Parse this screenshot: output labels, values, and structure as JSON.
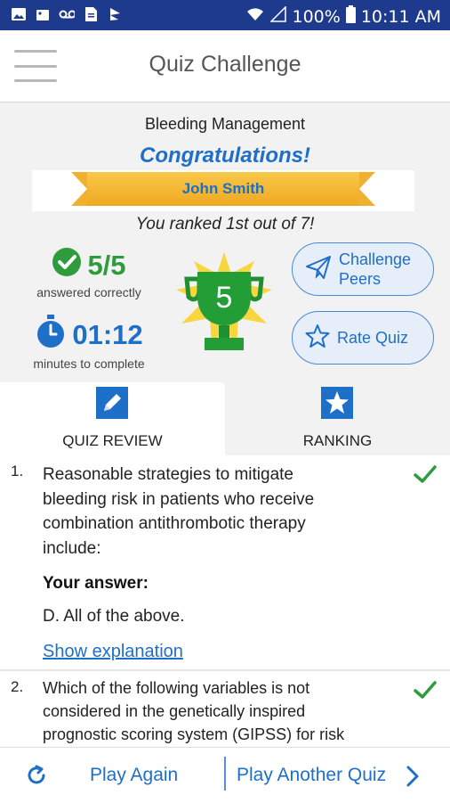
{
  "status_bar": {
    "battery": "100%",
    "time": "10:11 AM"
  },
  "app_bar": {
    "title": "Quiz Challenge"
  },
  "summary": {
    "quiz_name": "Bleeding Management",
    "congrats": "Congratulations!",
    "user_name": "John Smith",
    "ranked_text": "You ranked 1st out of 7!",
    "score": "5/5",
    "score_label": "answered correctly",
    "time": "01:12",
    "time_label": "minutes to complete",
    "trophy_number": "5",
    "challenge_label_1": "Challenge",
    "challenge_label_2": "Peers",
    "rate_label": "Rate Quiz"
  },
  "tabs": [
    {
      "label": "QUIZ REVIEW",
      "icon": "pencil-icon",
      "active": true
    },
    {
      "label": "RANKING",
      "icon": "star-icon",
      "active": false
    }
  ],
  "questions": [
    {
      "num": "1.",
      "line1": "Reasonable strategies to mitigate",
      "line2": "bleeding risk in patients who receive",
      "line3": "combination antithrombotic therapy",
      "line4": "include:",
      "answer_label": "Your answer:",
      "answer": "D. All of the above.",
      "explain": "Show explanation",
      "correct": true
    },
    {
      "num": "2.",
      "line1": "Which of the following variables is not",
      "line2": "considered in the genetically inspired",
      "line3": "prognostic scoring system (GIPSS) for risk",
      "correct": true
    }
  ],
  "footer": {
    "play_again": "Play Again",
    "play_another": "Play Another Quiz"
  },
  "colors": {
    "primary": "#1e6fc8",
    "status_bar": "#1e3a8c",
    "green": "#2e9c3c",
    "gold": "#f5b82e"
  }
}
